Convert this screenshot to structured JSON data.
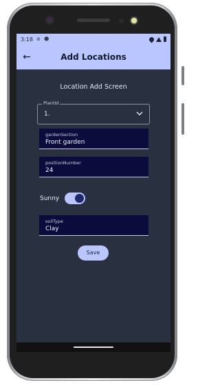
{
  "status_bar": {
    "time": "3:18"
  },
  "app_bar": {
    "title": "Add Locations"
  },
  "screen": {
    "heading": "Location Add Screen"
  },
  "form": {
    "plant_id": {
      "label": "PlantId",
      "value": "1."
    },
    "garden_section": {
      "label": "gardenSection",
      "value": "Front garden"
    },
    "position_number": {
      "label": "positionNumber",
      "value": "24"
    },
    "sunny": {
      "label": "Sunny",
      "checked": true
    },
    "soil_type": {
      "label": "soilType",
      "value": "Clay"
    },
    "save_label": "Save"
  },
  "colors": {
    "accent": "#b9c6ff",
    "background": "#293040",
    "field_fill": "#0c0c3c"
  }
}
